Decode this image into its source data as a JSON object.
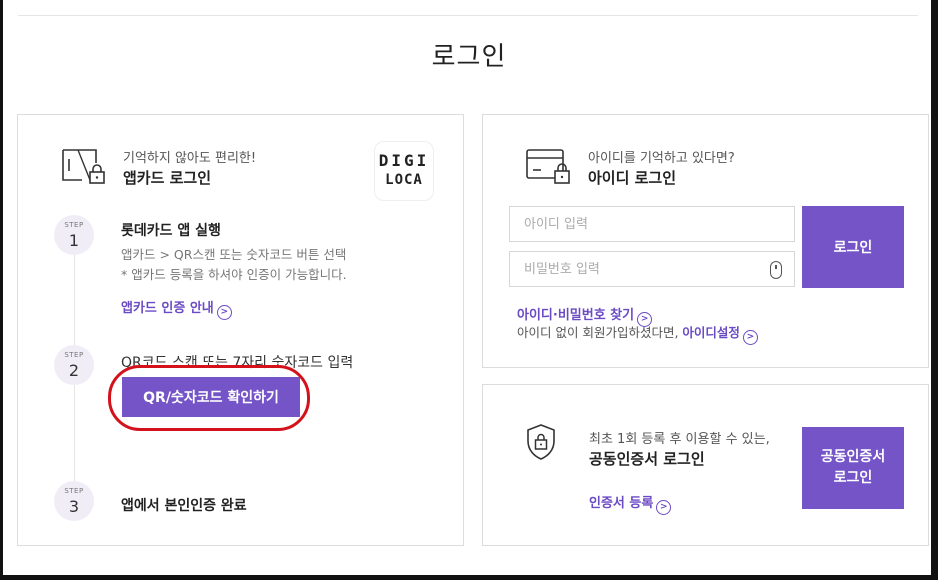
{
  "page": {
    "title": "로그인"
  },
  "appcard": {
    "subtitle": "기억하지 않아도 편리한!",
    "title": "앱카드 로그인",
    "logo_line1": "DIGI",
    "logo_line2": "LOCA",
    "steps": [
      {
        "label": "STEP",
        "number": "1",
        "title": "롯데카드 앱 실행",
        "desc_line1": "앱카드 > QR스캔 또는 숫자코드 버튼 선택",
        "desc_line2": "* 앱카드 등록을 하셔야 인증이 가능합니다.",
        "link": "앱카드 인증 안내"
      },
      {
        "label": "STEP",
        "number": "2",
        "title": "QR코드 스캔 또는 7자리 숫자코드 입력",
        "button": "QR/숫자코드 확인하기"
      },
      {
        "label": "STEP",
        "number": "3",
        "title": "앱에서 본인인증 완료"
      }
    ]
  },
  "id_login": {
    "subtitle": "아이디를 기억하고 있다면?",
    "title": "아이디 로그인",
    "id_placeholder": "아이디 입력",
    "pw_placeholder": "비밀번호 입력",
    "login_button": "로그인",
    "find_link": "아이디·비밀번호 찾기",
    "note_text": "아이디 없이 회원가입하셨다면,",
    "note_link": "아이디설정"
  },
  "cert_login": {
    "subtitle": "최초 1회 등록 후 이용할 수 있는,",
    "title": "공동인증서 로그인",
    "register_link": "인증서 등록",
    "button_line1": "공동인증서",
    "button_line2": "로그인"
  },
  "colors": {
    "accent": "#7454c7",
    "highlight_ring": "#d4121c"
  },
  "icons": [
    "card-lock-icon",
    "card-id-lock-icon",
    "shield-lock-icon",
    "mouse-icon",
    "chevron-right-icon"
  ]
}
